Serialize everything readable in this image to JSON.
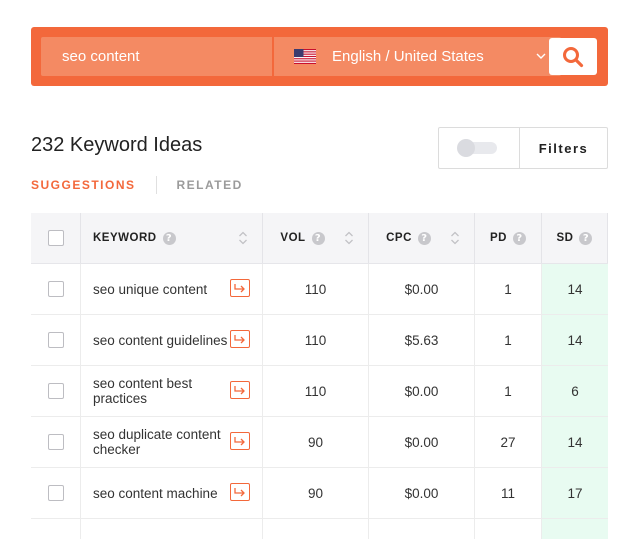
{
  "search": {
    "query": "seo content",
    "language_label": "English / United States",
    "flag_icon": "us-flag-icon",
    "accent_color": "#f3683b"
  },
  "results": {
    "title": "232 Keyword Ideas",
    "filters_label": "Filters",
    "tabs": [
      {
        "label": "SUGGESTIONS",
        "active": true
      },
      {
        "label": "RELATED",
        "active": false
      }
    ]
  },
  "table": {
    "columns": [
      {
        "label": "KEYWORD"
      },
      {
        "label": "VOL"
      },
      {
        "label": "CPC"
      },
      {
        "label": "PD"
      },
      {
        "label": "SD"
      }
    ],
    "help_glyph": "?",
    "rows": [
      {
        "keyword": "seo unique content",
        "vol": "110",
        "cpc": "$0.00",
        "pd": "1",
        "sd": "14"
      },
      {
        "keyword": "seo content guidelines",
        "vol": "110",
        "cpc": "$5.63",
        "pd": "1",
        "sd": "14"
      },
      {
        "keyword": "seo content best practices",
        "vol": "110",
        "cpc": "$0.00",
        "pd": "1",
        "sd": "6"
      },
      {
        "keyword": "seo duplicate content checker",
        "vol": "90",
        "cpc": "$0.00",
        "pd": "27",
        "sd": "14"
      },
      {
        "keyword": "seo content machine",
        "vol": "90",
        "cpc": "$0.00",
        "pd": "11",
        "sd": "17"
      }
    ]
  }
}
